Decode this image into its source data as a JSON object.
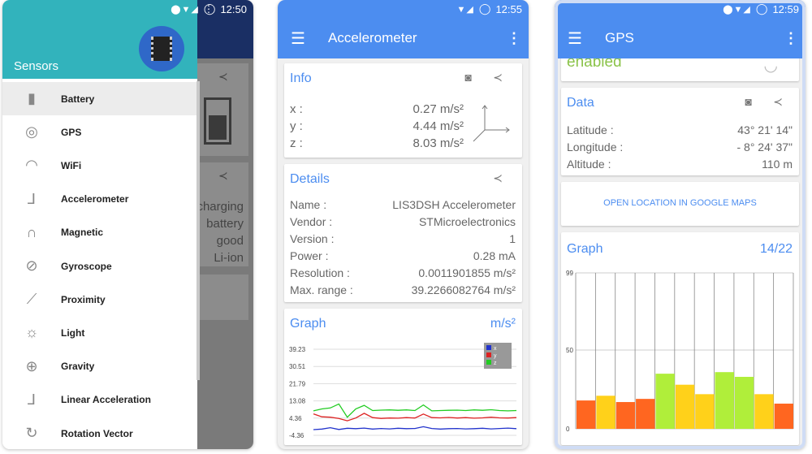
{
  "phone1": {
    "status": {
      "time": "12:50"
    },
    "drawer": {
      "title": "Sensors",
      "items": [
        {
          "label": "Battery",
          "icon": "battery-icon",
          "glyph": "▮",
          "active": true
        },
        {
          "label": "GPS",
          "icon": "gps-icon",
          "glyph": "◎"
        },
        {
          "label": "WiFi",
          "icon": "wifi-icon",
          "glyph": "◠"
        },
        {
          "label": "Accelerometer",
          "icon": "accelerometer-icon",
          "glyph": "⅃"
        },
        {
          "label": "Magnetic",
          "icon": "magnet-icon",
          "glyph": "∩"
        },
        {
          "label": "Gyroscope",
          "icon": "gyroscope-icon",
          "glyph": "⊘"
        },
        {
          "label": "Proximity",
          "icon": "proximity-icon",
          "glyph": "⟋"
        },
        {
          "label": "Light",
          "icon": "light-icon",
          "glyph": "☼"
        },
        {
          "label": "Gravity",
          "icon": "globe-icon",
          "glyph": "⊕"
        },
        {
          "label": "Linear Acceleration",
          "icon": "linear-acceleration-icon",
          "glyph": "⅃"
        },
        {
          "label": "Rotation Vector",
          "icon": "rotation-icon",
          "glyph": "↻"
        }
      ]
    },
    "background": {
      "battery_lines": [
        "charging",
        "battery",
        "good",
        "Li-ion"
      ]
    }
  },
  "phone2": {
    "status": {
      "time": "12:55"
    },
    "title": "Accelerometer",
    "info": {
      "title": "Info",
      "rows": [
        {
          "k": "x :",
          "v": "0.27 m/s²"
        },
        {
          "k": "y :",
          "v": "4.44 m/s²"
        },
        {
          "k": "z :",
          "v": "8.03 m/s²"
        }
      ]
    },
    "details": {
      "title": "Details",
      "rows": [
        {
          "k": "Name :",
          "v": "LIS3DSH Accelerometer"
        },
        {
          "k": "Vendor :",
          "v": "STMicroelectronics"
        },
        {
          "k": "Version :",
          "v": "1"
        },
        {
          "k": "Power :",
          "v": "0.28 mA"
        },
        {
          "k": "Resolution :",
          "v": "0.0011901855 m/s²"
        },
        {
          "k": "Max. range :",
          "v": "39.2266082764 m/s²"
        }
      ]
    },
    "graph": {
      "title": "Graph",
      "unit": "m/s²"
    }
  },
  "phone3": {
    "status": {
      "time": "12:59"
    },
    "title": "GPS",
    "top_status": "enabled",
    "data": {
      "title": "Data",
      "rows": [
        {
          "k": "Latitude :",
          "v": "43° 21' 14\""
        },
        {
          "k": "Longitude :",
          "v": "- 8° 24' 37\""
        },
        {
          "k": "Altitude :",
          "v": "110 m"
        }
      ]
    },
    "maps_button": "OPEN LOCATION IN GOOGLE MAPS",
    "graph": {
      "title": "Graph",
      "count": "14/22"
    }
  },
  "chart_data": [
    {
      "type": "line",
      "title": "Graph",
      "ylabel": "m/s²",
      "yticks": [
        "39.23",
        "30.51",
        "21.79",
        "13.08",
        "4.36",
        "-4.36"
      ],
      "ylim": [
        -4.36,
        39.23
      ],
      "legend": [
        "x",
        "y",
        "z"
      ],
      "legend_position": "top-right",
      "colors": {
        "x": "#2233cc",
        "y": "#dd2222",
        "z": "#22cc22"
      },
      "series": [
        {
          "name": "x",
          "values": [
            -1.5,
            -1.2,
            -0.5,
            -1.4,
            -0.8,
            -1.0,
            -0.7,
            -1.2,
            -0.9,
            -1.1,
            -0.8,
            -1.0,
            -0.9,
            0.0,
            -0.9,
            -1.2,
            -1.0,
            -0.9,
            -1.1,
            -1.0,
            -0.8,
            -1.1,
            -0.9,
            -0.7,
            -1.0
          ]
        },
        {
          "name": "y",
          "values": [
            6.5,
            5.0,
            4.8,
            4.2,
            3.0,
            4.4,
            6.8,
            4.6,
            4.2,
            4.4,
            4.3,
            4.6,
            4.4,
            6.4,
            4.6,
            4.5,
            4.7,
            4.4,
            4.6,
            4.3,
            4.5,
            4.8,
            4.5,
            4.4,
            4.6
          ]
        },
        {
          "name": "z",
          "values": [
            8.0,
            9.0,
            9.5,
            11.5,
            4.8,
            9.0,
            10.8,
            8.2,
            8.4,
            8.5,
            8.3,
            8.5,
            8.2,
            11.0,
            8.0,
            8.2,
            8.3,
            8.4,
            8.2,
            8.5,
            8.3,
            8.6,
            8.2,
            8.0,
            8.2
          ]
        }
      ]
    },
    {
      "type": "bar",
      "title": "Graph",
      "yticks": [
        "99",
        "50",
        "0"
      ],
      "ylim": [
        0,
        99
      ],
      "values": [
        18,
        21,
        17,
        19,
        35,
        28,
        22,
        36,
        33,
        22,
        16
      ],
      "colors": [
        "#ff6620",
        "#ffd11a",
        "#ff6620",
        "#ff6620",
        "#b0ee3a",
        "#ffd11a",
        "#ffd11a",
        "#b0ee3a",
        "#b0ee3a",
        "#ffd11a",
        "#ff6620"
      ]
    }
  ]
}
